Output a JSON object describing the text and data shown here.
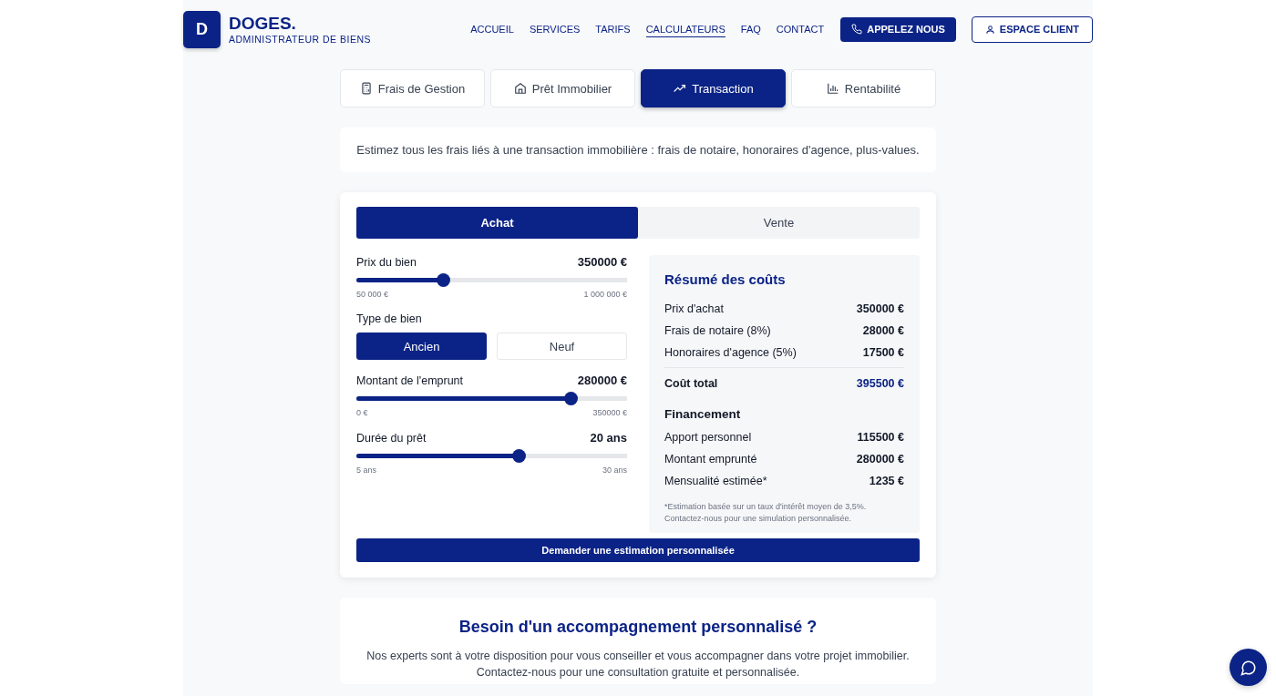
{
  "brand": {
    "letter": "D",
    "name": "DOGES.",
    "tagline": "ADMINISTRATEUR DE BIENS"
  },
  "nav": [
    {
      "label": "ACCUEIL",
      "selected": false
    },
    {
      "label": "SERVICES",
      "selected": false
    },
    {
      "label": "TARIFS",
      "selected": false
    },
    {
      "label": "CALCULATEURS",
      "selected": true
    },
    {
      "label": "FAQ",
      "selected": false
    },
    {
      "label": "CONTACT",
      "selected": false
    }
  ],
  "call_button": "APPELEZ NOUS",
  "client_button": "ESPACE CLIENT",
  "calculator_tabs": [
    {
      "label": "Frais de Gestion",
      "kind": "calculator",
      "selected": false
    },
    {
      "label": "Prêt Immobilier",
      "kind": "home",
      "selected": false
    },
    {
      "label": "Transaction",
      "kind": "trend",
      "selected": true
    },
    {
      "label": "Rentabilité",
      "kind": "chart",
      "selected": false
    }
  ],
  "description": "Estimez tous les frais liés à une transaction immobilière : frais de notaire, honoraires d'agence, plus-values.",
  "mode_tabs": [
    {
      "label": "Achat",
      "selected": true
    },
    {
      "label": "Vente",
      "selected": false
    }
  ],
  "inputs": [
    {
      "kind": "slider",
      "label": "Prix du bien",
      "value": "350000 €",
      "level": 0.32,
      "min": "50 000 €",
      "max": "1 000 000 €"
    },
    {
      "kind": "choice",
      "label": "Type de bien",
      "options": [
        {
          "label": "Ancien",
          "selected": true
        },
        {
          "label": "Neuf",
          "selected": false
        }
      ]
    },
    {
      "kind": "slider",
      "label": "Montant de l'emprunt",
      "value": "280000 €",
      "level": 0.79,
      "min": "0 €",
      "max": "350000 €"
    },
    {
      "kind": "slider",
      "label": "Durée du prêt",
      "value": "20 ans",
      "level": 0.6,
      "min": "5 ans",
      "max": "30 ans"
    }
  ],
  "summary": {
    "title": "Résumé des coûts",
    "costs": [
      {
        "label": "Prix d'achat",
        "value": "350000 €"
      },
      {
        "label": "Frais de notaire (8%)",
        "value": "28000 €"
      },
      {
        "label": "Honoraires d'agence (5%)",
        "value": "17500 €"
      }
    ],
    "total": {
      "label": "Coût total",
      "value": "395500 €"
    },
    "financing_title": "Financement",
    "financing": [
      {
        "label": "Apport personnel",
        "value": "115500 €"
      },
      {
        "label": "Montant emprunté",
        "value": "280000 €"
      },
      {
        "label": "Mensualité estimée*",
        "value": "1235 €"
      }
    ],
    "footnote": "*Estimation basée sur un taux d'intérêt moyen de 3,5%. Contactez-nous pour une simulation personnalisée."
  },
  "estimate_button": "Demander une estimation personnalisée",
  "support": {
    "title": "Besoin d'un accompagnement personnalisé ?",
    "lines": [
      "Nos experts sont à votre disposition pour vous conseiller et vous accompagner dans votre projet immobilier.",
      "Contactez-nous pour une consultation gratuite et personnalisée."
    ]
  }
}
